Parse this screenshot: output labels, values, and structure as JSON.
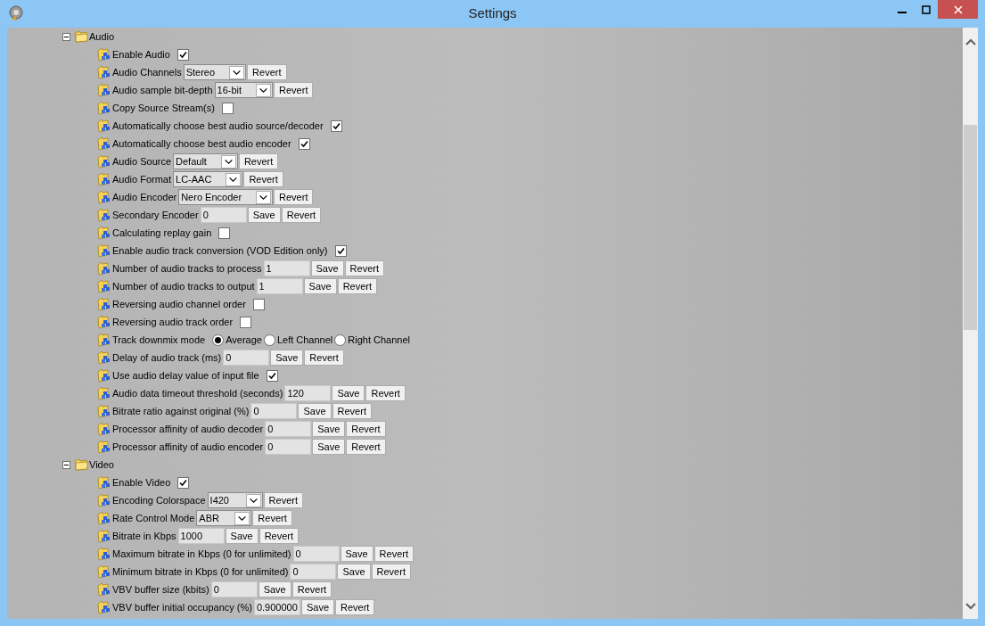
{
  "window": {
    "title": "Settings"
  },
  "groups": [
    {
      "label": "Audio",
      "expanded": true,
      "items": [
        {
          "kind": "checkbox",
          "label": "Enable Audio",
          "checked": true
        },
        {
          "kind": "select",
          "label": "Audio Channels",
          "value": "Stereo",
          "buttons": [
            "Revert"
          ]
        },
        {
          "kind": "select",
          "label": "Audio sample bit-depth",
          "value": "16-bit",
          "buttons": [
            "Revert"
          ]
        },
        {
          "kind": "checkbox",
          "label": "Copy Source Stream(s)",
          "checked": false
        },
        {
          "kind": "checkbox",
          "label": "Automatically choose best audio source/decoder",
          "checked": true
        },
        {
          "kind": "checkbox",
          "label": "Automatically choose best audio encoder",
          "checked": true
        },
        {
          "kind": "select",
          "label": "Audio Source",
          "value": "Default",
          "buttons": [
            "Revert"
          ]
        },
        {
          "kind": "select",
          "label": "Audio Format",
          "value": "LC-AAC",
          "buttons": [
            "Revert"
          ]
        },
        {
          "kind": "select",
          "label": "Audio Encoder",
          "value": "Nero Encoder",
          "buttons": [
            "Revert"
          ]
        },
        {
          "kind": "text",
          "label": "Secondary Encoder",
          "value": "0",
          "buttons": [
            "Save",
            "Revert"
          ]
        },
        {
          "kind": "checkbox",
          "label": "Calculating replay gain",
          "checked": false
        },
        {
          "kind": "checkbox",
          "label": "Enable audio track conversion (VOD Edition only)",
          "checked": true
        },
        {
          "kind": "text",
          "label": "Number of audio tracks to process",
          "value": "1",
          "buttons": [
            "Save",
            "Revert"
          ]
        },
        {
          "kind": "text",
          "label": "Number of audio tracks to output",
          "value": "1",
          "buttons": [
            "Save",
            "Revert"
          ]
        },
        {
          "kind": "checkbox",
          "label": "Reversing audio channel order",
          "checked": false
        },
        {
          "kind": "checkbox",
          "label": "Reversing audio track order",
          "checked": false
        },
        {
          "kind": "radio",
          "label": "Track downmix mode",
          "options": [
            {
              "label": "Average",
              "selected": true
            },
            {
              "label": "Left Channel",
              "selected": false
            },
            {
              "label": "Right Channel",
              "selected": false
            }
          ]
        },
        {
          "kind": "text",
          "label": "Delay of audio track (ms)",
          "value": "0",
          "buttons": [
            "Save",
            "Revert"
          ]
        },
        {
          "kind": "checkbox",
          "label": "Use audio delay value of input file",
          "checked": true
        },
        {
          "kind": "text",
          "label": "Audio data timeout threshold (seconds)",
          "value": "120",
          "buttons": [
            "Save",
            "Revert"
          ]
        },
        {
          "kind": "text",
          "label": "Bitrate ratio against original (%)",
          "value": "0",
          "buttons": [
            "Save",
            "Revert"
          ]
        },
        {
          "kind": "text",
          "label": "Processor affinity of audio decoder",
          "value": "0",
          "buttons": [
            "Save",
            "Revert"
          ]
        },
        {
          "kind": "text",
          "label": "Processor affinity of audio encoder",
          "value": "0",
          "buttons": [
            "Save",
            "Revert"
          ]
        }
      ]
    },
    {
      "label": "Video",
      "expanded": true,
      "items": [
        {
          "kind": "checkbox",
          "label": "Enable Video",
          "checked": true
        },
        {
          "kind": "select",
          "label": "Encoding Colorspace",
          "value": "I420",
          "buttons": [
            "Revert"
          ]
        },
        {
          "kind": "select",
          "label": "Rate Control Mode",
          "value": "ABR",
          "buttons": [
            "Revert"
          ]
        },
        {
          "kind": "text",
          "label": "Bitrate in Kbps",
          "value": "1000",
          "buttons": [
            "Save",
            "Revert"
          ]
        },
        {
          "kind": "text",
          "label": "Maximum bitrate in Kbps (0 for unlimited)",
          "value": "0",
          "buttons": [
            "Save",
            "Revert"
          ]
        },
        {
          "kind": "text",
          "label": "Minimum bitrate in Kbps (0 for unlimited)",
          "value": "0",
          "buttons": [
            "Save",
            "Revert"
          ]
        },
        {
          "kind": "text",
          "label": "VBV buffer size (kbits)",
          "value": "0",
          "buttons": [
            "Save",
            "Revert"
          ]
        },
        {
          "kind": "text",
          "label": "VBV buffer initial occupancy (%)",
          "value": "0.900000",
          "buttons": [
            "Save",
            "Revert"
          ]
        }
      ]
    }
  ]
}
